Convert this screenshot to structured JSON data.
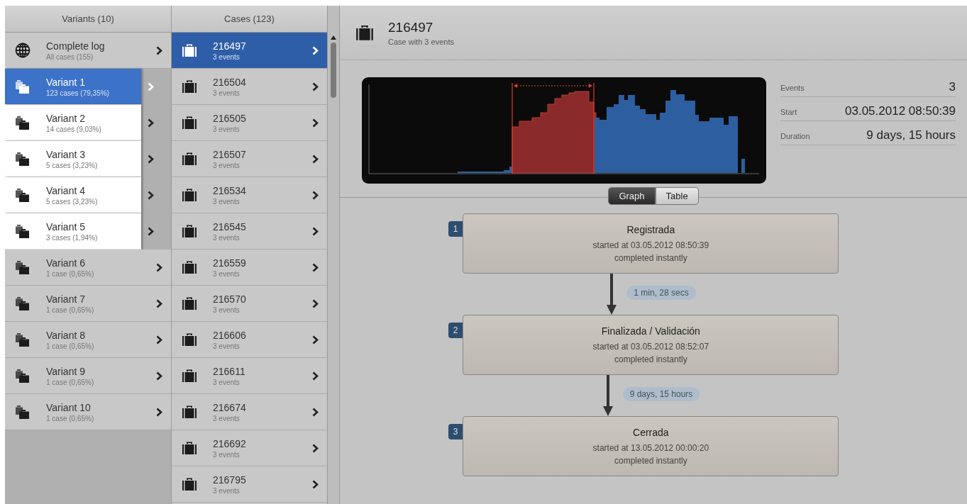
{
  "variants": {
    "title": "Variants (10)",
    "complete_log": {
      "name": "Complete log",
      "detail": "All cases (155)",
      "selected": false
    },
    "items": [
      {
        "name": "Variant 1",
        "detail": "123 cases (79,35%)",
        "selected": true,
        "highlighted": true
      },
      {
        "name": "Variant 2",
        "detail": "14 cases (9,03%)",
        "selected": false,
        "highlighted": true
      },
      {
        "name": "Variant 3",
        "detail": "5 cases (3,23%)",
        "selected": false,
        "highlighted": true
      },
      {
        "name": "Variant 4",
        "detail": "5 cases (3,23%)",
        "selected": false,
        "highlighted": true
      },
      {
        "name": "Variant 5",
        "detail": "3 cases (1,94%)",
        "selected": false,
        "highlighted": true
      },
      {
        "name": "Variant 6",
        "detail": "1 case (0,65%)",
        "selected": false,
        "highlighted": false
      },
      {
        "name": "Variant 7",
        "detail": "1 case (0,65%)",
        "selected": false,
        "highlighted": false
      },
      {
        "name": "Variant 8",
        "detail": "1 case (0,65%)",
        "selected": false,
        "highlighted": false
      },
      {
        "name": "Variant 9",
        "detail": "1 case (0,65%)",
        "selected": false,
        "highlighted": false
      },
      {
        "name": "Variant 10",
        "detail": "1 case (0,65%)",
        "selected": false,
        "highlighted": false
      }
    ]
  },
  "cases": {
    "title": "Cases (123)",
    "items": [
      {
        "id": "216497",
        "detail": "3 events",
        "selected": true
      },
      {
        "id": "216504",
        "detail": "3 events",
        "selected": false
      },
      {
        "id": "216505",
        "detail": "3 events",
        "selected": false
      },
      {
        "id": "216507",
        "detail": "3 events",
        "selected": false
      },
      {
        "id": "216534",
        "detail": "3 events",
        "selected": false
      },
      {
        "id": "216545",
        "detail": "3 events",
        "selected": false
      },
      {
        "id": "216559",
        "detail": "3 events",
        "selected": false
      },
      {
        "id": "216570",
        "detail": "3 events",
        "selected": false
      },
      {
        "id": "216606",
        "detail": "3 events",
        "selected": false
      },
      {
        "id": "216611",
        "detail": "3 events",
        "selected": false
      },
      {
        "id": "216674",
        "detail": "3 events",
        "selected": false
      },
      {
        "id": "216692",
        "detail": "3 events",
        "selected": false
      },
      {
        "id": "216795",
        "detail": "3 events",
        "selected": false
      }
    ]
  },
  "case_detail": {
    "title": "216497",
    "subtitle": "Case with 3 events",
    "stats": [
      {
        "label": "Events",
        "value": "3"
      },
      {
        "label": "Start",
        "value": "03.05.2012 08:50:39"
      },
      {
        "label": "Duration",
        "value": "9 days, 15 hours"
      }
    ],
    "view_tabs": [
      {
        "label": "Graph",
        "selected": true
      },
      {
        "label": "Table",
        "selected": false
      }
    ],
    "steps": [
      {
        "number": "1",
        "name": "Registrada",
        "started": "started at 03.05.2012 08:50:39",
        "completed": "completed instantly"
      },
      {
        "number": "2",
        "name": "Finalizada / Validación",
        "started": "started at 03.05.2012 08:52:07",
        "completed": "completed instantly"
      },
      {
        "number": "3",
        "name": "Cerrada",
        "started": "started at 13.05.2012 00:00:20",
        "completed": "completed instantly"
      }
    ],
    "transitions": [
      "1 min, 28 secs",
      "9 days, 15 hours"
    ]
  }
}
